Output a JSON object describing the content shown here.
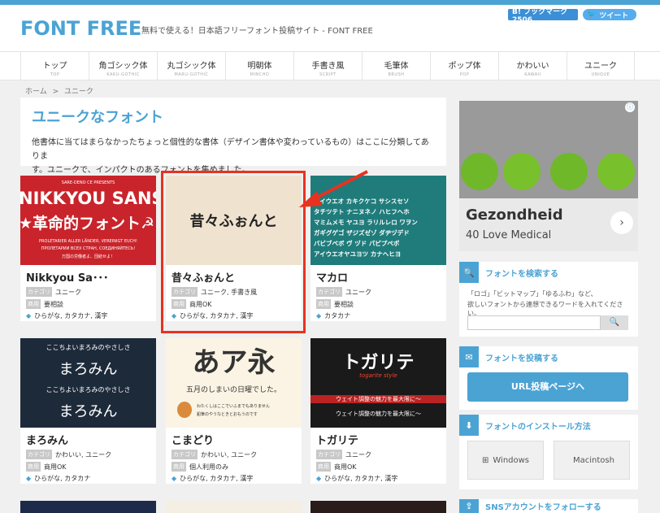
{
  "header": {
    "logo": "FONT FREE",
    "tagline": "無料で使える！日本語フリーフォント投稿サイト - FONT FREE",
    "hatena_label": "B! ブックマーク 2506",
    "tweet_label": "ツイート"
  },
  "nav": [
    {
      "label": "トップ",
      "sub": "TOP"
    },
    {
      "label": "角ゴシック体",
      "sub": "KAKU-GOTHIC"
    },
    {
      "label": "丸ゴシック体",
      "sub": "MARU-GOTHIC"
    },
    {
      "label": "明朝体",
      "sub": "MINCHO"
    },
    {
      "label": "手書き風",
      "sub": "SCRIPT"
    },
    {
      "label": "毛筆体",
      "sub": "BRUSH"
    },
    {
      "label": "ポップ体",
      "sub": "POP"
    },
    {
      "label": "かわいい",
      "sub": "KAWAII"
    },
    {
      "label": "ユニーク",
      "sub": "UNIQUE"
    }
  ],
  "breadcrumb": {
    "home": "ホーム",
    "sep": ">",
    "current": "ユニーク"
  },
  "intro": {
    "title": "ユニークなフォント",
    "line1": "他書体に当てはまらなかったちょっと個性的な書体（デザイン書体や変わっているもの）はここに分類してありま",
    "line2": "す。ユニークで、インパクトのあるフォントを集めました。"
  },
  "labels": {
    "category": "カテゴリ",
    "license": "商用"
  },
  "cards": [
    {
      "title": "Nikkyou Sa･･･",
      "category": "ユニーク",
      "license": "要相談",
      "chars": "ひらがな, カタカナ, 漢字",
      "thumb_line1": "NIKKYOU SANS",
      "thumb_line2": "★革命的フォント☭",
      "thumb_top": "SARE-DENO CE PRESENTS",
      "thumb_small1": "PROLETARIER ALLER LÄNDER, VEREINIGT EUCH!",
      "thumb_small2": "ПРОЛЕТАРИИ ВСЕХ СТРАН, СОЕДИНЯЙТЕСЬ!",
      "thumb_small3": "万国の労働者よ、団結せよ！"
    },
    {
      "title": "昔々ふぉんと",
      "category": "ユニーク, 手書き風",
      "license": "商用OK",
      "chars": "ひらがな, カタカナ, 漢字",
      "thumb_line1": "昔々ふぉんと"
    },
    {
      "title": "マカロ",
      "category": "ユニーク",
      "license": "要相談",
      "chars": "カタカナ",
      "thumb_line1": "アイウエオ カキクケコ サシスセソ",
      "thumb_line2": "タチツテト ナニヌネノ ハヒフヘホ",
      "thumb_line3": "マミムメモ ヤユヨ ラリルレロ ワヲン",
      "thumb_line4": "ガギグゲゴ ザジズゼゾ ダヂヅデド",
      "thumb_line5": "バビブベボ ヴ ヅド パピプペポ",
      "thumb_line6": "アイウエオヤユヨツ カナヘヒヨ"
    },
    {
      "title": "まろみん",
      "category": "かわいい, ユニーク",
      "license": "商用OK",
      "chars": "ひらがな, カタカナ",
      "thumb_line1": "ここちよいまろみのやさしさ",
      "thumb_line2": "まろみん",
      "thumb_line3": "ここちよいまろみのやさしさ",
      "thumb_line4": "まろみん"
    },
    {
      "title": "こまどり",
      "category": "かわいい, ユニーク",
      "license": "個人利用のみ",
      "chars": "ひらがな, カタカナ, 漢字",
      "thumb_line1": "あア永",
      "thumb_line2": "五月のしまいの日曜でした。",
      "thumb_line3": "わたくしはここでいふまでもありません",
      "thumb_line4": "鉛筆のやうなときとおもうのです"
    },
    {
      "title": "トガリテ",
      "category": "ユニーク",
      "license": "商用OK",
      "chars": "ひらがな, カタカナ, 漢字",
      "thumb_line1": "トガリテ",
      "thumb_line2": "togarite style",
      "thumb_line3": "ウェイト調整の魅力を最大限に～",
      "thumb_line4": "ウェイト調整の魅力を最大限に～"
    }
  ],
  "sidebar": {
    "ad_title": "Gezondheid",
    "ad_sub": "40 Love Medical",
    "search_title": "フォントを検索する",
    "search_hint1": "「ロゴ」「ビットマップ」「ゆるふわ」など、",
    "search_hint2": "欲しいフォントから連想できるワードを入れてください。",
    "post_title": "フォントを投稿する",
    "post_button": "URL投稿ページへ",
    "install_title": "フォントのインストール方法",
    "windows": "Windows",
    "mac": "Macintosh",
    "sns_title": "SNSアカウントをフォローする"
  },
  "colors": {
    "accent": "#4ba3d4",
    "highlight": "#e8321f"
  }
}
